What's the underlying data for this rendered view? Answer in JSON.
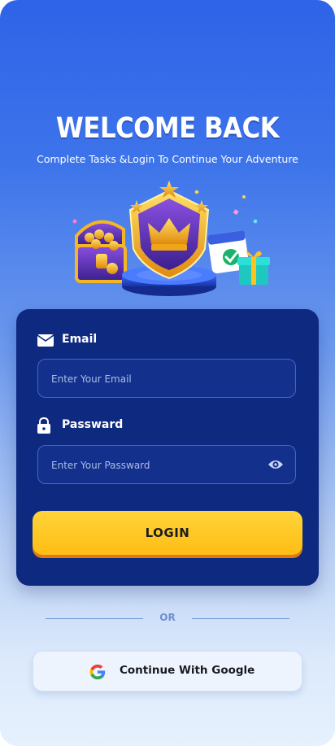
{
  "header": {
    "title": "WELCOME BACK",
    "subtitle": "Complete Tasks &Login To Continue Your Adventure"
  },
  "hero": {
    "icons": [
      "treasure-chest-icon",
      "crown-shield-icon",
      "calendar-check-icon",
      "gift-box-icon"
    ]
  },
  "form": {
    "email": {
      "label": "Email",
      "icon": "envelope-icon",
      "placeholder": "Enter Your Email",
      "value": ""
    },
    "password": {
      "label": "Passward",
      "icon": "lock-icon",
      "placeholder": "Enter Your Passward",
      "value": "",
      "toggle_icon": "eye-icon"
    },
    "login_label": "LOGIN"
  },
  "divider": {
    "text": "OR"
  },
  "google": {
    "label": "Continue With Google",
    "icon": "google-icon"
  },
  "colors": {
    "card": "#0e2a80",
    "accent_yellow": "#ffc21f",
    "bg_top": "#2f63e8",
    "bg_bottom": "#e6f1fd"
  }
}
